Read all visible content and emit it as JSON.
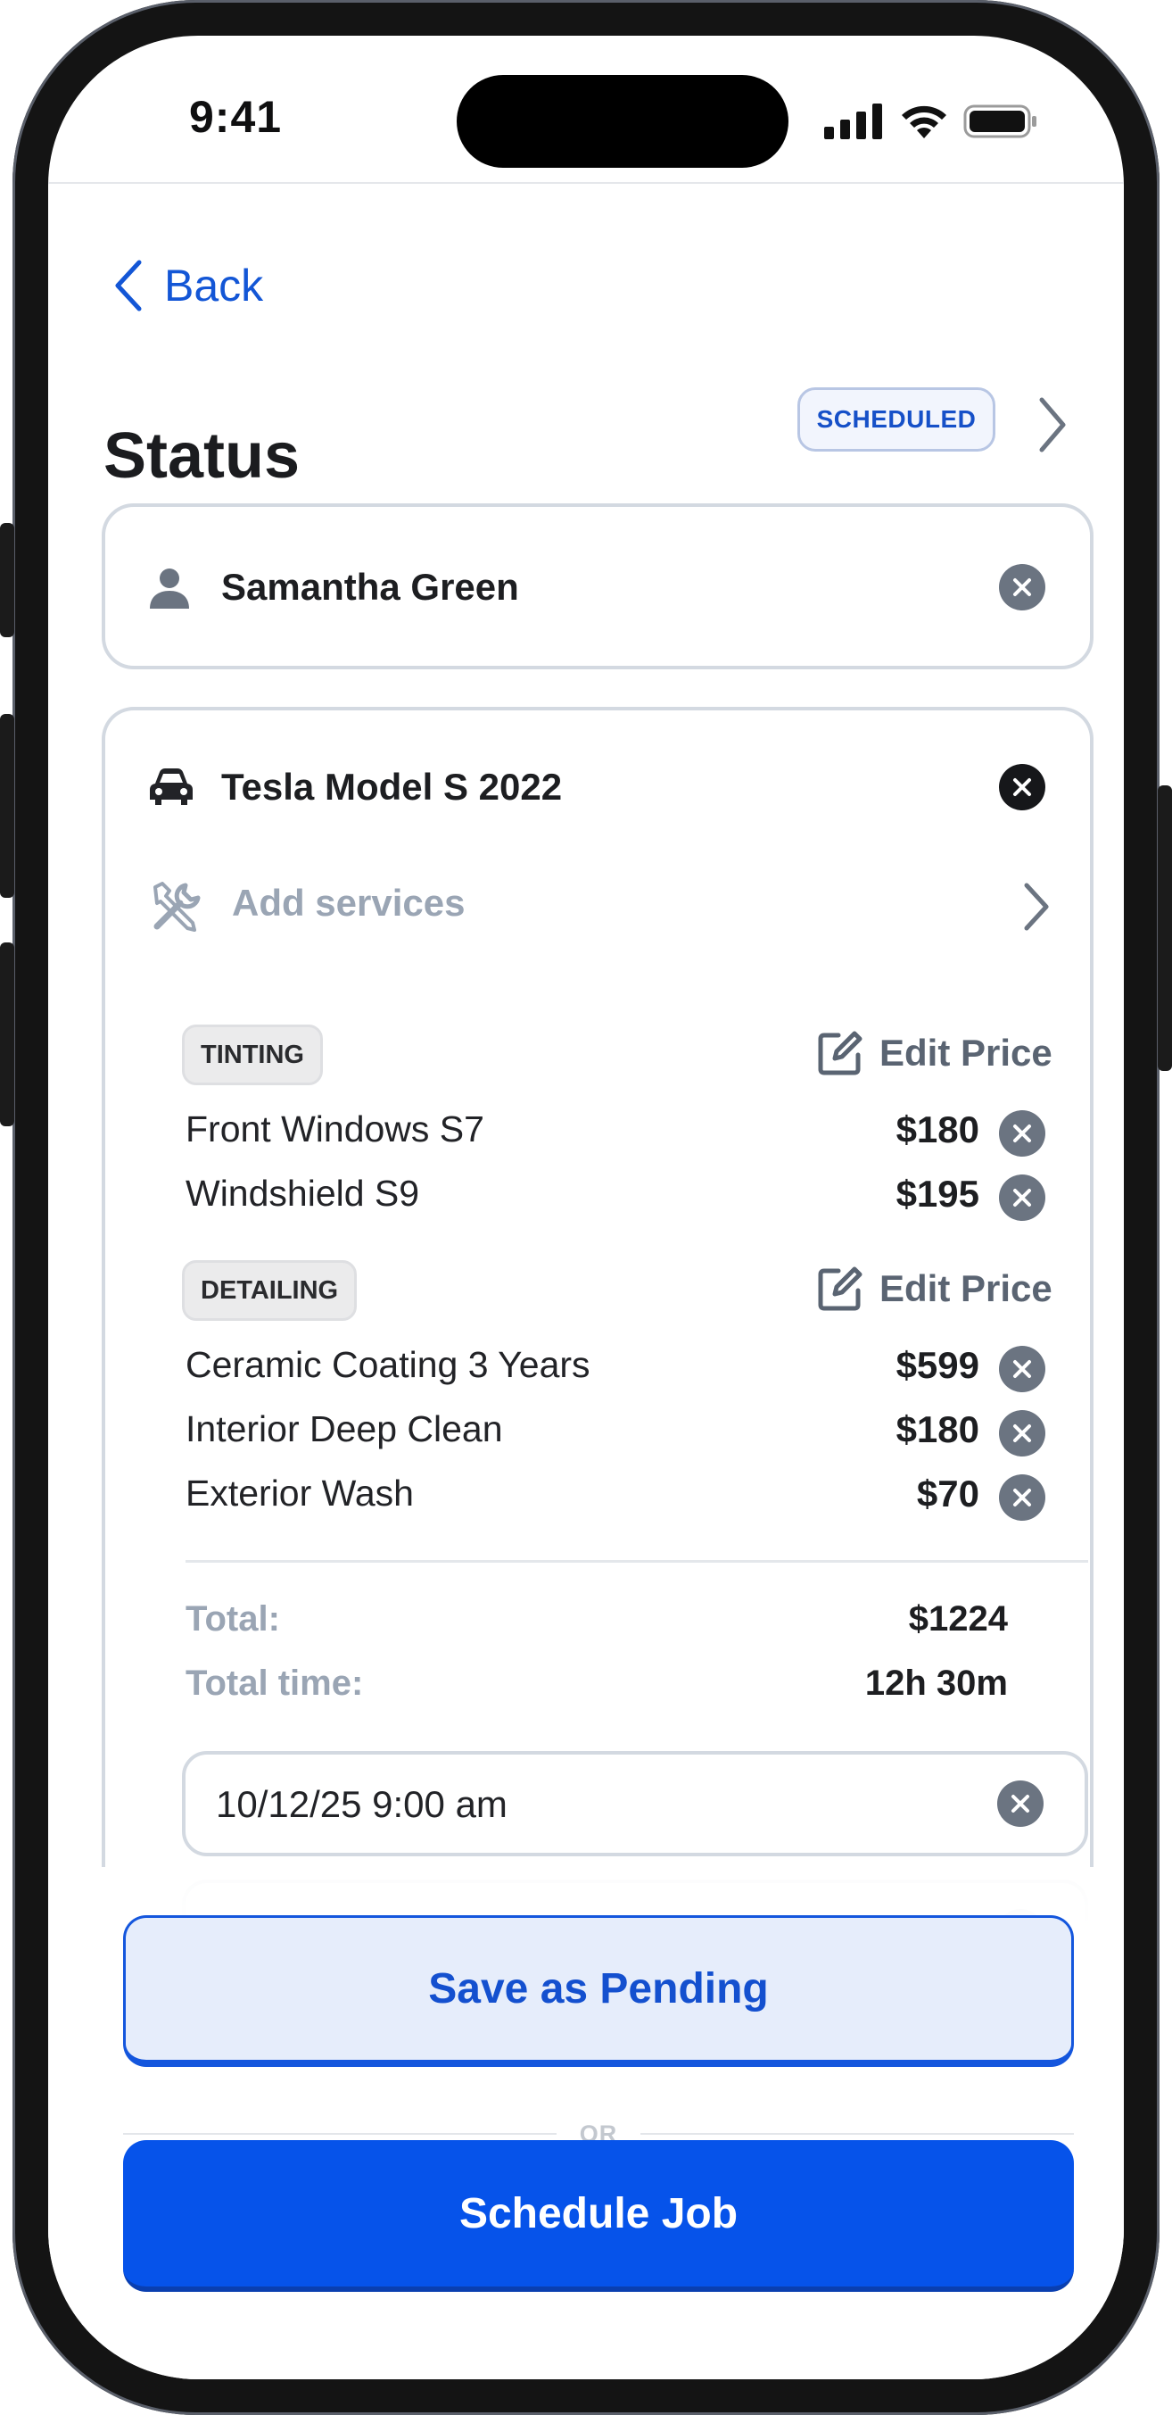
{
  "status_bar": {
    "time": "9:41"
  },
  "nav": {
    "back_label": "Back"
  },
  "header": {
    "title": "Status",
    "status_badge": "SCHEDULED"
  },
  "customer": {
    "name": "Samantha Green",
    "icon": "person-icon"
  },
  "vehicle": {
    "name": "Tesla Model S 2022",
    "icon": "car-icon",
    "add_services_label": "Add services",
    "groups": [
      {
        "category": "TINTING",
        "edit_label": "Edit Price",
        "items": [
          {
            "name": "Front Windows S7",
            "price": "$180"
          },
          {
            "name": "Windshield S9",
            "price": "$195"
          }
        ]
      },
      {
        "category": "DETAILING",
        "edit_label": "Edit Price",
        "items": [
          {
            "name": "Ceramic Coating 3 Years",
            "price": "$599"
          },
          {
            "name": "Interior Deep Clean",
            "price": "$180"
          },
          {
            "name": "Exterior Wash",
            "price": "$70"
          }
        ]
      }
    ],
    "total_label": "Total:",
    "total_value": "$1224",
    "time_label": "Total time:",
    "time_value": "12h 30m",
    "datetime_value": "10/12/25 9:00 am"
  },
  "actions": {
    "save_pending_label": "Save as Pending",
    "or_label": "OR",
    "schedule_label": "Schedule Job"
  },
  "colors": {
    "accent": "#0653ea",
    "badge_text": "#1650c8",
    "muted": "#9aa5b4"
  }
}
